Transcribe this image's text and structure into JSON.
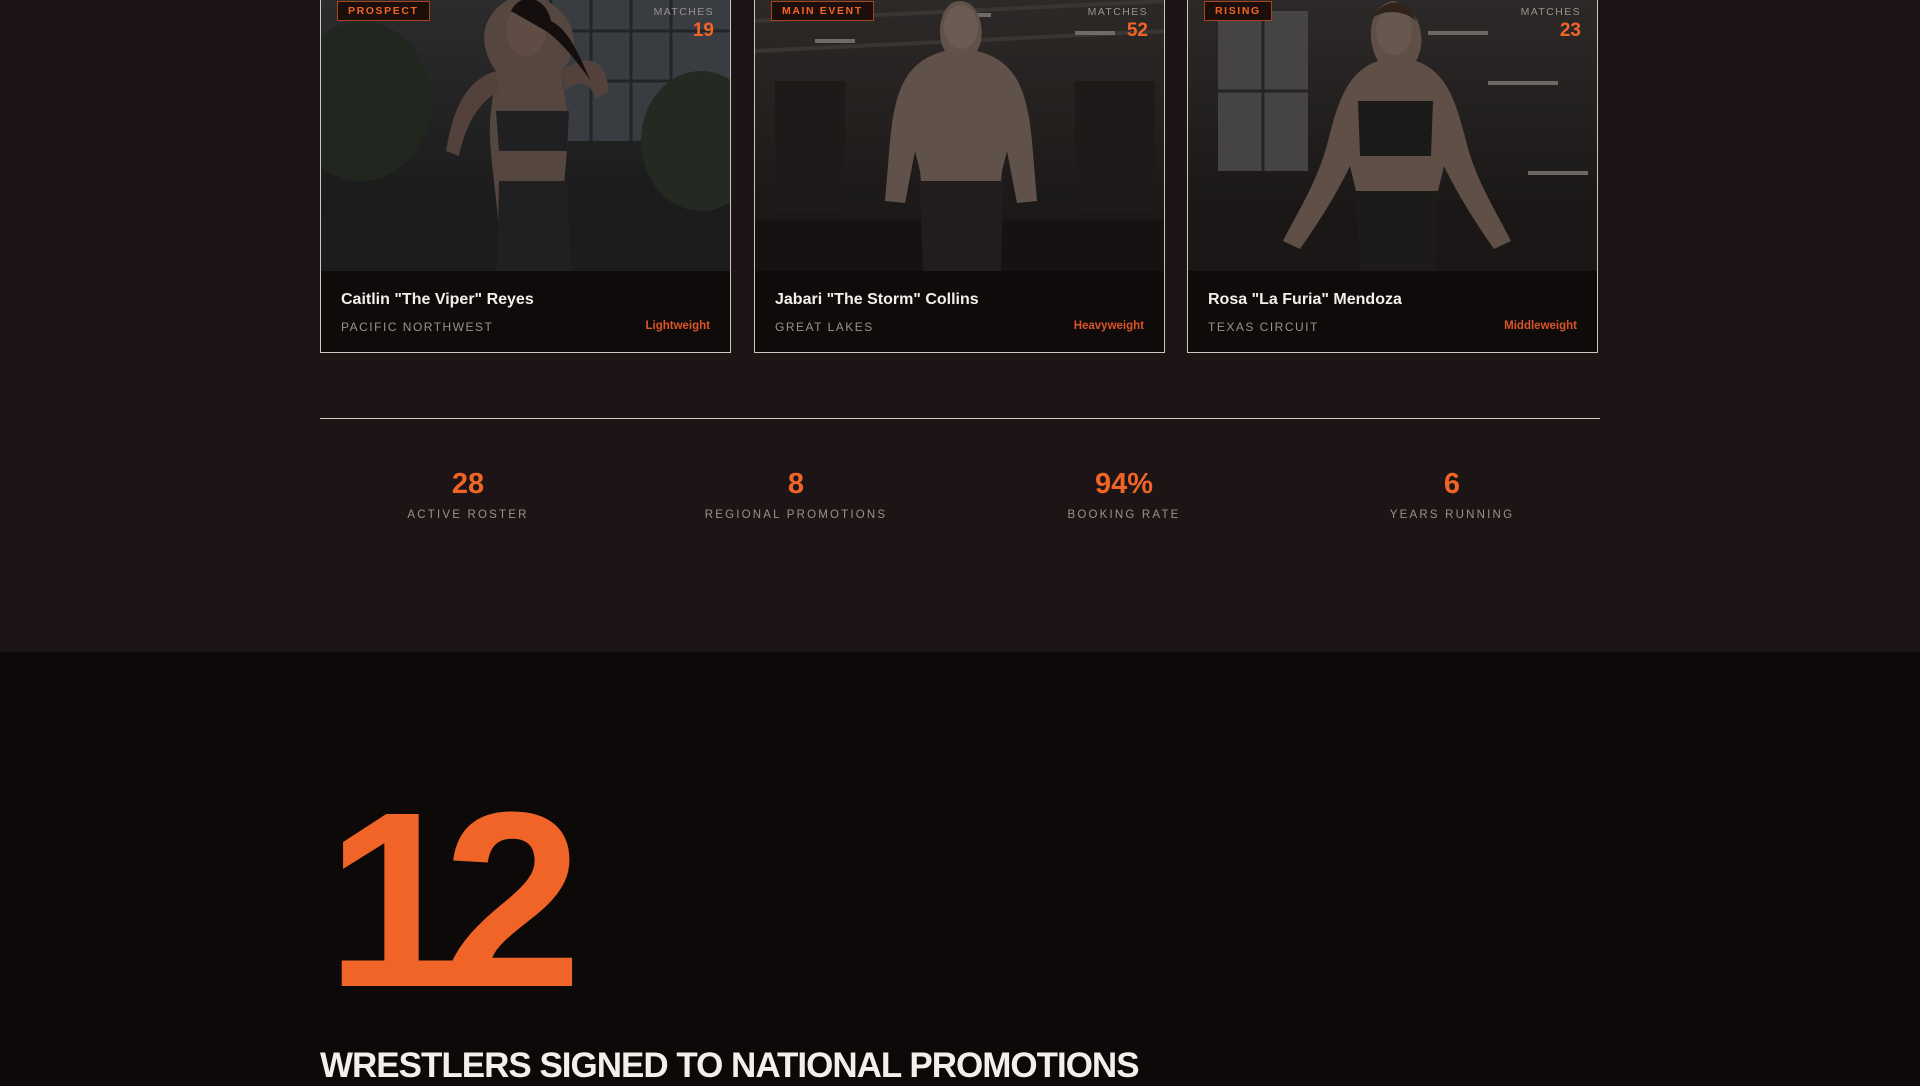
{
  "roster": {
    "cards": [
      {
        "tier": "PROSPECT",
        "matches_label": "MATCHES",
        "matches": "19",
        "name": "Caitlin \"The Viper\" Reyes",
        "region": "PACIFIC NORTHWEST",
        "weight_class": "Lightweight"
      },
      {
        "tier": "MAIN EVENT",
        "matches_label": "MATCHES",
        "matches": "52",
        "name": "Jabari \"The Storm\" Collins",
        "region": "GREAT LAKES",
        "weight_class": "Heavyweight"
      },
      {
        "tier": "RISING",
        "matches_label": "MATCHES",
        "matches": "23",
        "name": "Rosa \"La Furia\" Mendoza",
        "region": "TEXAS CIRCUIT",
        "weight_class": "Middleweight"
      }
    ]
  },
  "stats": [
    {
      "value": "28",
      "label": "ACTIVE ROSTER"
    },
    {
      "value": "8",
      "label": "REGIONAL PROMOTIONS"
    },
    {
      "value": "94%",
      "label": "BOOKING RATE"
    },
    {
      "value": "6",
      "label": "YEARS RUNNING"
    }
  ],
  "highlight": {
    "number": "12",
    "caption": "WRESTLERS SIGNED TO NATIONAL PROMOTIONS"
  },
  "colors": {
    "accent": "#f06427",
    "upper_bg": "#1d1515",
    "lower_bg": "#0d0909",
    "card_border": "#cfc6c3"
  }
}
